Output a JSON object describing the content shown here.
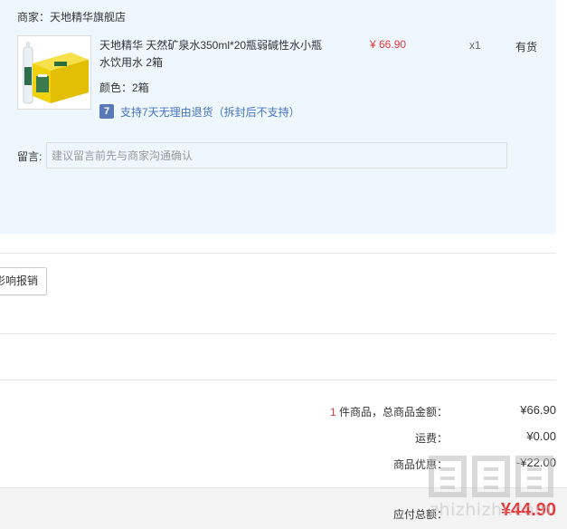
{
  "order": {
    "seller_label": "商家：天地精华旗舰店",
    "product": {
      "name": "天地精华 天然矿泉水350ml*20瓶弱碱性水小瓶水饮用水 2箱",
      "price": "¥ 66.90",
      "quantity": "x1",
      "stock_status": "有货",
      "variant": "颜色：2箱",
      "thumbnail_icon": "product-thumbnail-water-box",
      "return_policy_icon_text": "7",
      "return_policy": "支持7天无理由退货（拆封后不支持）"
    },
    "remark": {
      "label": "留言:",
      "placeholder": "建议留言前先与商家沟通确认"
    }
  },
  "invoice": {
    "button_label": "影响报销"
  },
  "summary": {
    "goods_count": "1",
    "goods_label": " 件商品，总商品金额：",
    "goods_amount": "¥66.90",
    "shipping_label": "运费：",
    "shipping_amount": "¥0.00",
    "discount_label": "商品优惠：",
    "discount_amount": "-¥22.00",
    "total_label": "应付总额：",
    "total_amount": "¥44.90"
  },
  "watermark": {
    "logo_text": "值值值",
    "site": "zhizhizhi.com"
  },
  "colors": {
    "accent_red": "#e4393c",
    "panel_bg": "#eef7fd",
    "link_blue": "#4673c4"
  }
}
